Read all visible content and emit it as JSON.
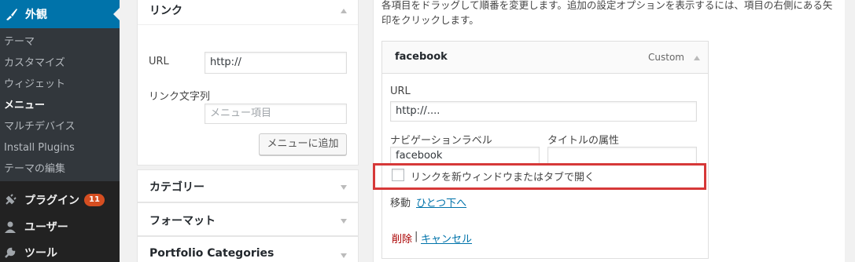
{
  "sidebar": {
    "appearance_label": "外観",
    "submenu": [
      "テーマ",
      "カスタマイズ",
      "ウィジェット",
      "メニュー",
      "マルチデバイス",
      "Install Plugins",
      "テーマの編集"
    ],
    "plugins_label": "プラグイン",
    "plugins_badge": "11",
    "users_label": "ユーザー",
    "tools_label": "ツール"
  },
  "links_panel": {
    "title": "リンク",
    "url_label": "URL",
    "url_value": "http://",
    "link_text_label": "リンク文字列",
    "link_text_placeholder": "メニュー項目",
    "add_button": "メニューに追加"
  },
  "panels": {
    "categories": "カテゴリー",
    "format": "フォーマット",
    "portfolio": "Portfolio Categories"
  },
  "instructions": "各項目をドラッグして順番を変更します。追加の設定オプションを表示するには、項目の右側にある矢印をクリックします。",
  "menu_item": {
    "title": "facebook",
    "type": "Custom",
    "url_label": "URL",
    "url_value": "http://....",
    "nav_label": "ナビゲーションラベル",
    "nav_value": "facebook",
    "title_attr_label": "タイトルの属性",
    "title_attr_value": "",
    "new_window_label": "リンクを新ウィンドウまたはタブで開く",
    "move_label": "移動",
    "move_link": "ひとつ下へ",
    "delete": "削除",
    "separator": "|",
    "cancel": "キャンセル"
  }
}
